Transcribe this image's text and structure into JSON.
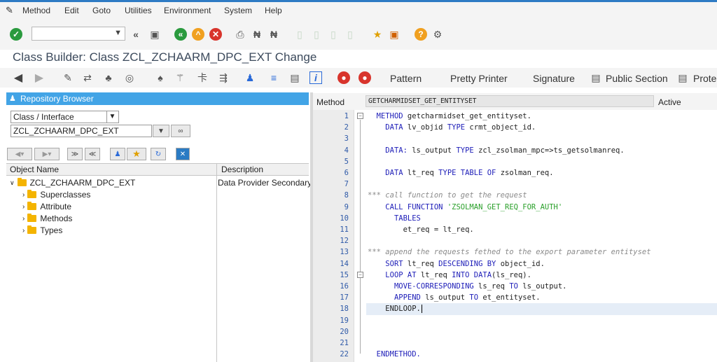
{
  "menu": [
    "Method",
    "Edit",
    "Goto",
    "Utilities",
    "Environment",
    "System",
    "Help"
  ],
  "title": "Class Builder: Class ZCL_ZCHAARM_DPC_EXT Change",
  "toolbar2": {
    "pattern": "Pattern",
    "pretty_printer": "Pretty Printer",
    "signature": "Signature",
    "public_section": "Public Section",
    "protected_section": "Prote"
  },
  "repo": {
    "header": "Repository Browser",
    "type_select": "Class / Interface",
    "object_input": "ZCL_ZCHAARM_DPC_EXT",
    "col_name": "Object Name",
    "col_desc": "Description",
    "root": "ZCL_ZCHAARM_DPC_EXT",
    "root_desc": "Data Provider Secondary",
    "children": [
      "Superclasses",
      "Attribute",
      "Methods",
      "Types"
    ]
  },
  "method_bar": {
    "label": "Method",
    "name": "GETCHARMIDSET_GET_ENTITYSET",
    "status": "Active"
  },
  "line_numbers": [
    "1",
    "2",
    "3",
    "4",
    "5",
    "6",
    "7",
    "8",
    "9",
    "10",
    "11",
    "12",
    "13",
    "14",
    "15",
    "16",
    "17",
    "18",
    "19",
    "20",
    "21",
    "22"
  ],
  "code": [
    {
      "indent": "",
      "parts": [
        {
          "t": "METHOD ",
          "c": "kw"
        },
        {
          "t": "getcharmidset_get_entityset.",
          "c": ""
        }
      ]
    },
    {
      "indent": "  ",
      "parts": [
        {
          "t": "DATA ",
          "c": "kw"
        },
        {
          "t": "lv_objid ",
          "c": ""
        },
        {
          "t": "TYPE ",
          "c": "kw"
        },
        {
          "t": "crmt_object_id.",
          "c": ""
        }
      ]
    },
    {
      "indent": "",
      "parts": []
    },
    {
      "indent": "  ",
      "parts": [
        {
          "t": "DATA: ",
          "c": "kw"
        },
        {
          "t": "ls_output ",
          "c": ""
        },
        {
          "t": "TYPE ",
          "c": "kw"
        },
        {
          "t": "zcl_zsolman_mpc=>ts_getsolmanreq.",
          "c": ""
        }
      ]
    },
    {
      "indent": "",
      "parts": []
    },
    {
      "indent": "  ",
      "parts": [
        {
          "t": "DATA ",
          "c": "kw"
        },
        {
          "t": "lt_req ",
          "c": ""
        },
        {
          "t": "TYPE TABLE OF ",
          "c": "kw"
        },
        {
          "t": "zsolman_req.",
          "c": ""
        }
      ]
    },
    {
      "indent": "",
      "parts": []
    },
    {
      "indent": "",
      "parts": [
        {
          "t": "*** call function to get the request",
          "c": "cmt"
        }
      ]
    },
    {
      "indent": "  ",
      "parts": [
        {
          "t": "CALL FUNCTION ",
          "c": "kw"
        },
        {
          "t": "'ZSOLMAN_GET_REQ_FOR_AUTH'",
          "c": "str"
        }
      ]
    },
    {
      "indent": "    ",
      "parts": [
        {
          "t": "TABLES",
          "c": "kw"
        }
      ]
    },
    {
      "indent": "      ",
      "parts": [
        {
          "t": "et_req = lt_req.",
          "c": ""
        }
      ]
    },
    {
      "indent": "",
      "parts": []
    },
    {
      "indent": "",
      "parts": [
        {
          "t": "*** append the requests fethed to the export parameter entityset",
          "c": "cmt"
        }
      ]
    },
    {
      "indent": "  ",
      "parts": [
        {
          "t": "SORT ",
          "c": "kw"
        },
        {
          "t": "lt_req ",
          "c": ""
        },
        {
          "t": "DESCENDING BY ",
          "c": "kw"
        },
        {
          "t": "object_id.",
          "c": ""
        }
      ]
    },
    {
      "indent": "  ",
      "parts": [
        {
          "t": "LOOP AT ",
          "c": "kw"
        },
        {
          "t": "lt_req ",
          "c": ""
        },
        {
          "t": "INTO DATA",
          "c": "kw"
        },
        {
          "t": "(ls_req).",
          "c": ""
        }
      ]
    },
    {
      "indent": "    ",
      "parts": [
        {
          "t": "MOVE-CORRESPONDING ",
          "c": "kw"
        },
        {
          "t": "ls_req ",
          "c": ""
        },
        {
          "t": "TO ",
          "c": "kw"
        },
        {
          "t": "ls_output.",
          "c": ""
        }
      ]
    },
    {
      "indent": "    ",
      "parts": [
        {
          "t": "APPEND ",
          "c": "kw"
        },
        {
          "t": "ls_output ",
          "c": ""
        },
        {
          "t": "TO ",
          "c": "kw"
        },
        {
          "t": "et_entityset.",
          "c": ""
        }
      ]
    },
    {
      "indent": "  ",
      "parts": [
        {
          "t": "ENDLOOP.",
          "c": ""
        }
      ]
    },
    {
      "indent": "",
      "parts": []
    },
    {
      "indent": "",
      "parts": []
    },
    {
      "indent": "",
      "parts": []
    },
    {
      "indent": "",
      "parts": [
        {
          "t": "ENDMETHOD.",
          "c": "kw"
        }
      ]
    }
  ],
  "colors": {
    "accent": "#42a4e6",
    "keyword": "#1d1db8",
    "string": "#2aa02a",
    "comment": "#8a8a8a"
  }
}
